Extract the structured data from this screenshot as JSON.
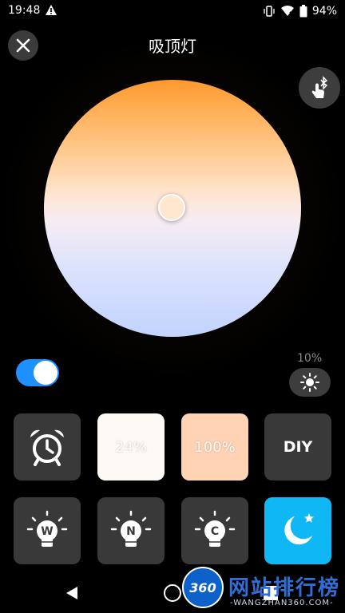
{
  "status_bar": {
    "time": "19:48",
    "battery_text": "94%",
    "icons": [
      "warning-icon",
      "vibrate-icon",
      "wifi-icon",
      "battery-icon"
    ]
  },
  "header": {
    "title": "吸顶灯",
    "close_icon": "close-icon",
    "bluetooth_icon": "bluetooth-touch-icon"
  },
  "color_wheel": {
    "top_color": "#ff9a2e",
    "middle_color": "#ffe6d2",
    "bottom_color": "#c2d3ff",
    "knob_color": "#ffe7cf"
  },
  "controls": {
    "power_on": true,
    "accent_color": "#1e90ff",
    "brightness_label": "10%",
    "brightness_icon": "sun-icon"
  },
  "presets": [
    {
      "type": "icon",
      "icon": "alarm-clock-icon",
      "bg": "#393939"
    },
    {
      "type": "text",
      "text": "24%",
      "bg": "#fdfaf5"
    },
    {
      "type": "text",
      "text": "100%",
      "bg": "#ffd3b4"
    },
    {
      "type": "text",
      "text": "DIY",
      "bg": "#393939"
    },
    {
      "type": "icon",
      "icon": "bulb-w-icon",
      "label": "W",
      "bg": "#393939"
    },
    {
      "type": "icon",
      "icon": "bulb-n-icon",
      "label": "N",
      "bg": "#393939"
    },
    {
      "type": "icon",
      "icon": "bulb-c-icon",
      "label": "C",
      "bg": "#393939"
    },
    {
      "type": "icon",
      "icon": "moon-star-icon",
      "bg": "#0fb8f5"
    }
  ],
  "nav": {
    "back": "back-icon",
    "home": "home-icon",
    "recent": "recent-icon"
  },
  "watermark": {
    "badge": "360",
    "title": "网站排行榜",
    "subtitle": "-WANGZHAN360.COM-"
  }
}
